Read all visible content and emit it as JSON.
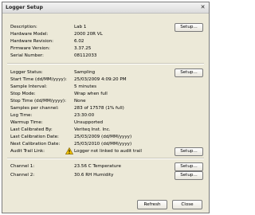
{
  "window": {
    "title": "Logger Setup",
    "close_glyph": "✕"
  },
  "section1": {
    "rows": [
      {
        "label": "Description:",
        "value": "Lab 1"
      },
      {
        "label": "Hardware Model:",
        "value": "2000 20R VL"
      },
      {
        "label": "Hardware Revision:",
        "value": "6.02"
      },
      {
        "label": "Firmware Version:",
        "value": "3.37.25"
      },
      {
        "label": "Serial Number:",
        "value": "08112033"
      }
    ],
    "setup_label": "Setup..."
  },
  "section2": {
    "rows": [
      {
        "label": "Logger Status:",
        "value": "Sampling"
      },
      {
        "label": "Start Time (dd/MM/yyyy):",
        "value": "25/03/2009 4:09:20 PM"
      },
      {
        "label": "Sample Interval:",
        "value": "5 minutes"
      },
      {
        "label": "Stop Mode:",
        "value": "Wrap when full"
      },
      {
        "label": "Stop Time (dd/MM/yyyy):",
        "value": "None"
      },
      {
        "label": "Samples per channel:",
        "value": "283 of 17578  (1% full)"
      },
      {
        "label": "Log Time:",
        "value": "23:30:00"
      },
      {
        "label": "Warmup Time:",
        "value": "Unsupported"
      },
      {
        "label": "Last Calibrated By:",
        "value": "Veriteq Inst. Inc."
      },
      {
        "label": "Last Calibration Date:",
        "value": "25/03/2009  (dd/MM/yyyy)"
      },
      {
        "label": "Next Calibration Date:",
        "value": "25/03/2010  (dd/MM/yyyy)"
      },
      {
        "label": "Audit Trail Link:",
        "value": "Logger not linked to audit trail"
      }
    ],
    "setup_label": "Setup...",
    "audit_setup_label": "Setup..."
  },
  "channels": [
    {
      "label": "Channel 1:",
      "value": "23.56 C   Temperature",
      "setup_label": "Setup..."
    },
    {
      "label": "Channel 2:",
      "value": "30.6 RH   Humidity",
      "setup_label": "Setup..."
    }
  ],
  "footer": {
    "refresh_label": "Refresh",
    "close_label": "Close"
  },
  "icons": {
    "warning": "warning-icon"
  },
  "colors": {
    "window_bg": "#ece9d8",
    "warning_fill": "#f5c400"
  }
}
